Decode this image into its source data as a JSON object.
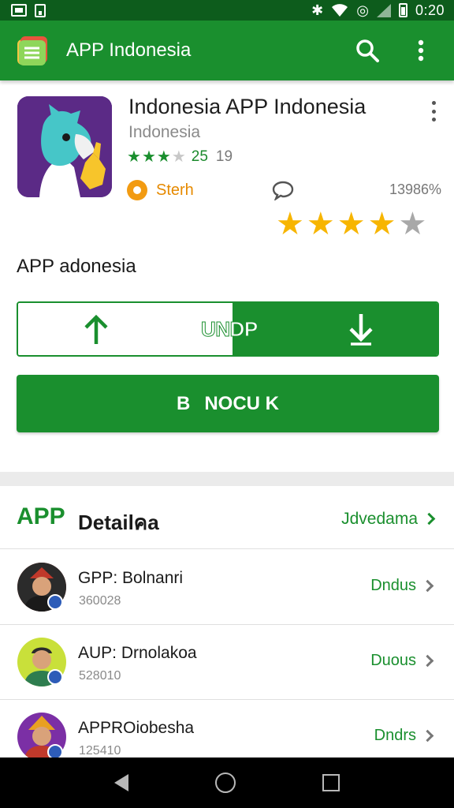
{
  "status_bar": {
    "time": "0:20"
  },
  "app_bar": {
    "title": "APP Indonesia"
  },
  "app": {
    "name": "Indonesia APP Indonesia",
    "developer": "Indonesia",
    "mini_rating_value": "25",
    "mini_rating_count": "19",
    "badge_label": "Sterh",
    "download_percent": "13986%",
    "big_stars_filled": 4,
    "big_stars_total": 5,
    "tagline": "APP adonesia"
  },
  "buttons": {
    "update_label": "UNDP",
    "install_icon": "B",
    "install_label": "NOCU K"
  },
  "details": {
    "heading_accent": "APP",
    "heading": "Detailคa",
    "link_label": "Jdvedama"
  },
  "list": [
    {
      "title": "GPP: Bolnanri",
      "subtitle": "360028",
      "action": "Dndus"
    },
    {
      "title": "AUP: Drnolakoa",
      "subtitle": "528010",
      "action": "Duous"
    },
    {
      "title": "APPROiobesha",
      "subtitle": "125410",
      "action": "Dndrs"
    }
  ],
  "colors": {
    "primary": "#1a8f2e",
    "status_bar": "#0d5c1c",
    "star": "#f7b500",
    "badge": "#f29b12"
  }
}
